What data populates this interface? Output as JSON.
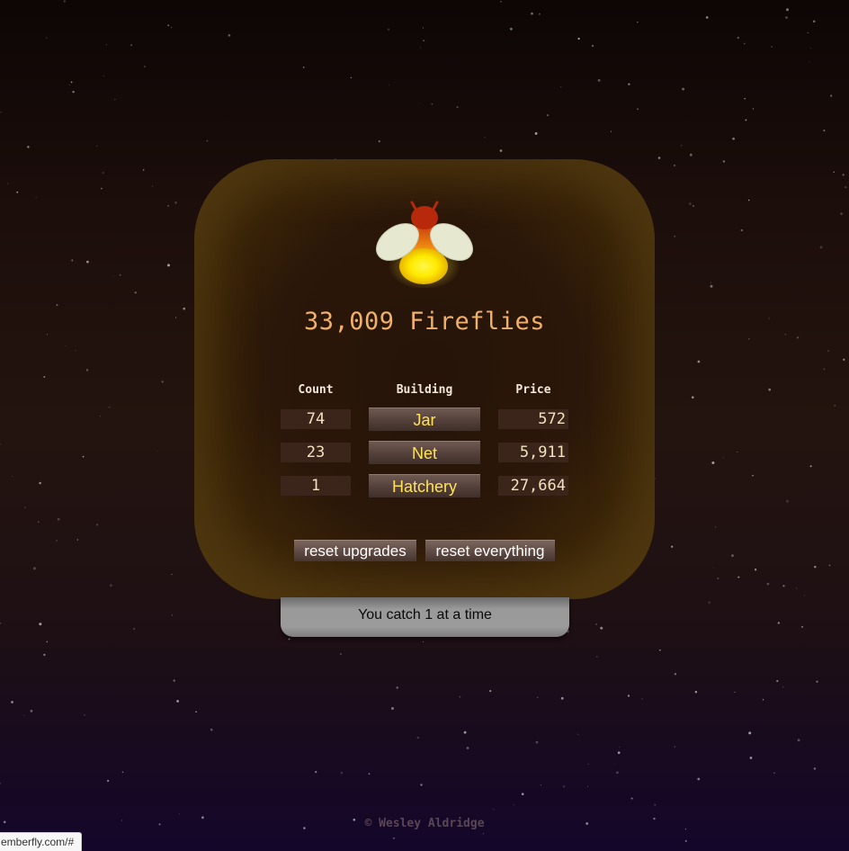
{
  "game": {
    "score_text": "33,009 Fireflies"
  },
  "table": {
    "headers": {
      "count": "Count",
      "building": "Building",
      "price": "Price"
    },
    "rows": [
      {
        "count": "74",
        "building": "Jar",
        "price": "572"
      },
      {
        "count": "23",
        "building": "Net",
        "price": "5,911"
      },
      {
        "count": "1",
        "building": "Hatchery",
        "price": "27,664"
      }
    ]
  },
  "controls": {
    "reset_upgrades": "reset upgrades",
    "reset_everything": "reset everything"
  },
  "catch_info": "You catch 1 at a time",
  "footer": "© Wesley Aldridge",
  "status_bar": {
    "url": "emberfly.com/#"
  },
  "colors": {
    "background_top": "#0d0605",
    "background_bottom": "#14062a",
    "card_glow": "#523a10",
    "score_text": "#f1b06a",
    "building_text": "#ffe25a",
    "firefly_glow": "#fff21a",
    "firefly_body": "#c83a0a"
  },
  "icons": {
    "firefly": "firefly-icon"
  }
}
